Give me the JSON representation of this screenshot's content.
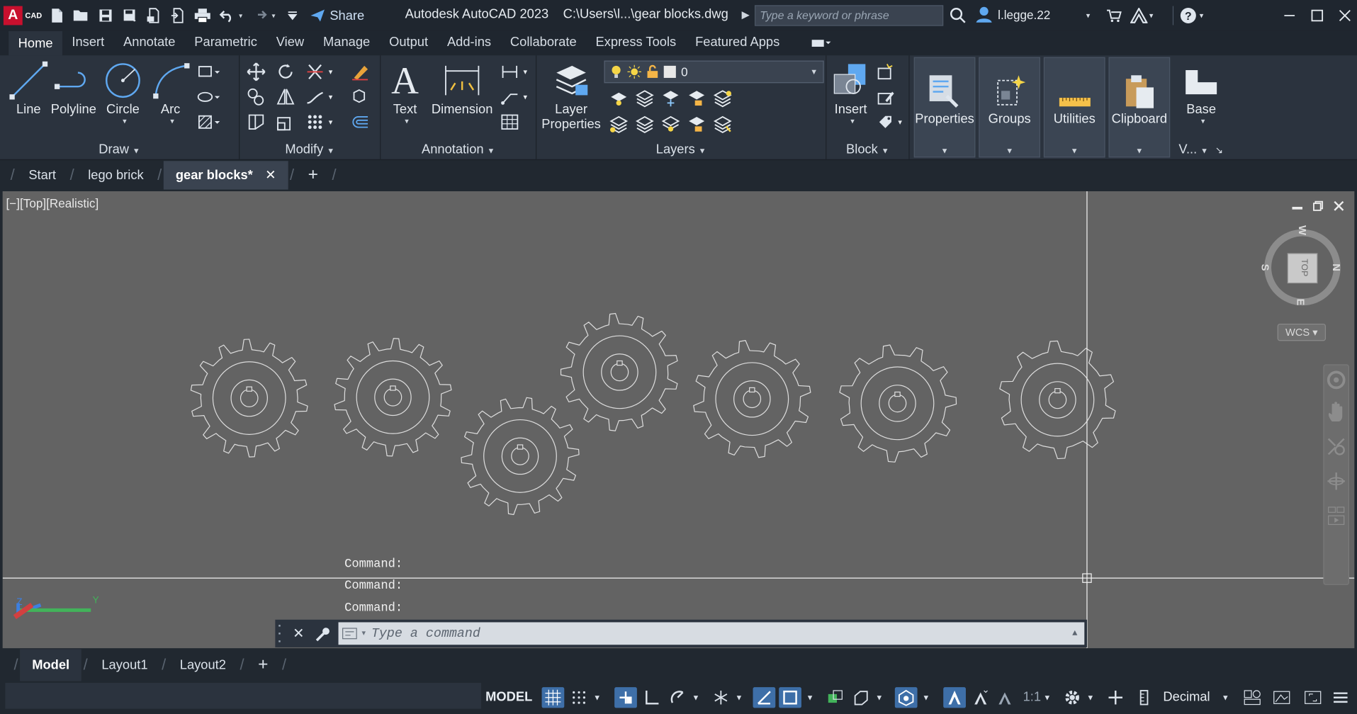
{
  "app": {
    "logo_letter": "A",
    "logo_sub": "CAD",
    "title": "Autodesk AutoCAD 2023",
    "file_path": "C:\\Users\\l...\\gear blocks.dwg",
    "share_label": "Share",
    "search_placeholder": "Type a keyword or phrase",
    "username": "l.legge.22"
  },
  "ribbon_tabs": [
    "Home",
    "Insert",
    "Annotate",
    "Parametric",
    "View",
    "Manage",
    "Output",
    "Add-ins",
    "Collaborate",
    "Express Tools",
    "Featured Apps"
  ],
  "ribbon": {
    "draw": {
      "title": "Draw",
      "line": "Line",
      "polyline": "Polyline",
      "circle": "Circle",
      "arc": "Arc"
    },
    "modify": {
      "title": "Modify"
    },
    "annotation": {
      "title": "Annotation",
      "text": "Text",
      "dimension": "Dimension"
    },
    "layers": {
      "title": "Layers",
      "layer_properties_1": "Layer",
      "layer_properties_2": "Properties",
      "current_layer": "0"
    },
    "block": {
      "title": "Block",
      "insert": "Insert"
    },
    "properties": "Properties",
    "groups": "Groups",
    "utilities": "Utilities",
    "clipboard": "Clipboard",
    "view": {
      "base": "Base",
      "title": "V..."
    }
  },
  "file_tabs": [
    "Start",
    "lego brick",
    "gear blocks*"
  ],
  "viewport": {
    "label": "[−][Top][Realistic]",
    "viewcube_face": "TOP",
    "compass": {
      "n": "N",
      "s": "S",
      "e": "E",
      "w": "W"
    },
    "wcs": "WCS",
    "command_history": [
      "Command:",
      "Command:",
      "Command:"
    ],
    "command_placeholder": "Type a command"
  },
  "layout_tabs": [
    "Model",
    "Layout1",
    "Layout2"
  ],
  "statusbar": {
    "model": "MODEL",
    "scale": "1:1",
    "units": "Decimal"
  },
  "colors": {
    "accent": "#3e6fa8",
    "background": "#212830",
    "ribbon": "#2b333e",
    "viewport": "#636363",
    "brand": "#c8102e"
  }
}
